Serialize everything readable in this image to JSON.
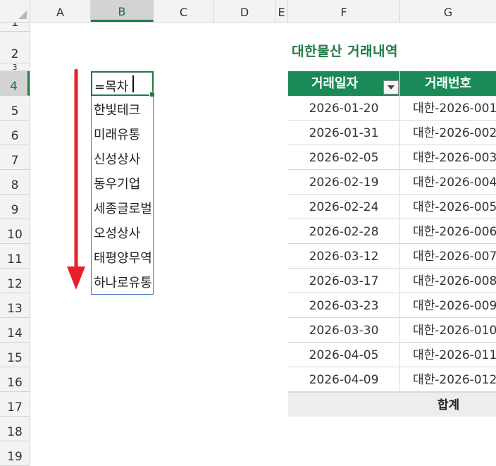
{
  "columns": [
    "A",
    "B",
    "C",
    "D",
    "E",
    "F",
    "G"
  ],
  "active_column": "B",
  "rows": [
    "1",
    "2",
    "3",
    "4",
    "5",
    "6",
    "7",
    "8",
    "9",
    "10",
    "11",
    "12",
    "13",
    "14",
    "15",
    "16",
    "17",
    "18",
    "19"
  ],
  "active_row": "4",
  "title": "대한물산 거래내역",
  "formula_cell": {
    "text": "=목차"
  },
  "spill_values": [
    "한빛테크",
    "미래유통",
    "신성상사",
    "동우기업",
    "세종글로벌",
    "오성상사",
    "태평양무역",
    "하나로유통"
  ],
  "table": {
    "headers": [
      "거래일자",
      "거래번호"
    ],
    "rows": [
      [
        "2026-01-20",
        "대한-2026-001"
      ],
      [
        "2026-01-31",
        "대한-2026-002"
      ],
      [
        "2026-02-05",
        "대한-2026-003"
      ],
      [
        "2026-02-19",
        "대한-2026-004"
      ],
      [
        "2026-02-24",
        "대한-2026-005"
      ],
      [
        "2026-02-28",
        "대한-2026-006"
      ],
      [
        "2026-03-12",
        "대한-2026-007"
      ],
      [
        "2026-03-17",
        "대한-2026-008"
      ],
      [
        "2026-03-23",
        "대한-2026-009"
      ],
      [
        "2026-03-30",
        "대한-2026-010"
      ],
      [
        "2026-04-05",
        "대한-2026-011"
      ],
      [
        "2026-04-09",
        "대한-2026-012"
      ]
    ],
    "total_label": "합계"
  },
  "icons": {
    "filter": "filter-dropdown-icon",
    "arrow": "down-arrow-icon"
  },
  "colors": {
    "accent_green": "#1a8a59",
    "title_green": "#1f7a45",
    "arrow_red": "#e8202a",
    "spill_border": "#3f74c9"
  }
}
